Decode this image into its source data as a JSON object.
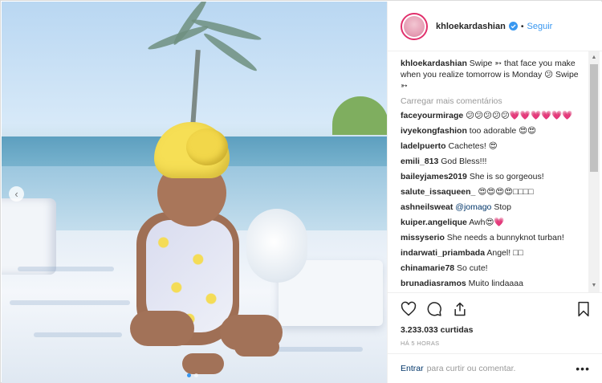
{
  "post": {
    "username": "khloekardashian",
    "follow_label": "Seguir",
    "dot": "•"
  },
  "caption": {
    "username": "khloekardashian",
    "text": "Swipe ➳ that face you make when you realize tomorrow is Monday 😕 Swipe ➳"
  },
  "load_more_label": "Carregar mais comentários",
  "comments": [
    {
      "user": "faceyourmirage",
      "text": "😕😕😕😕😕💗💗💗💗💗💗"
    },
    {
      "user": "ivyekongfashion",
      "text": "too adorable 😍😍"
    },
    {
      "user": "ladelpuerto",
      "text": "Cachetes! 😍"
    },
    {
      "user": "emili_813",
      "text": "God Bless!!!"
    },
    {
      "user": "baileyjames2019",
      "text": "She is so gorgeous!"
    },
    {
      "user": "salute_issaqueen_",
      "text": "😍😍😍😍□□□□"
    },
    {
      "user": "ashneilsweat",
      "text": "@jomago Stop"
    },
    {
      "user": "kuiper.angelique",
      "text": "Awh😍💗"
    },
    {
      "user": "missyserio",
      "text": "She needs a bunnyknot turban!"
    },
    {
      "user": "indarwati_priambada",
      "text": "Angel! □□"
    },
    {
      "user": "chinamarie78",
      "text": "So cute!"
    },
    {
      "user": "brunadiasramos",
      "text": "Muito lindaaaa"
    }
  ],
  "likes_label": "3.233.033 curtidas",
  "time_label": "HÁ 5 HORAS",
  "add_comment": {
    "login_label": "Entrar",
    "text": "para curtir ou comentar.",
    "more": "•••"
  },
  "icons": {
    "heart": "heart-icon",
    "comment": "comment-icon",
    "share": "share-icon",
    "bookmark": "bookmark-icon",
    "verified": "verified-badge-icon",
    "prev": "chevron-left-icon"
  },
  "colors": {
    "link_blue": "#3897f0",
    "dark_link": "#003569",
    "muted": "#999999",
    "turban_yellow": "#f6df55"
  }
}
